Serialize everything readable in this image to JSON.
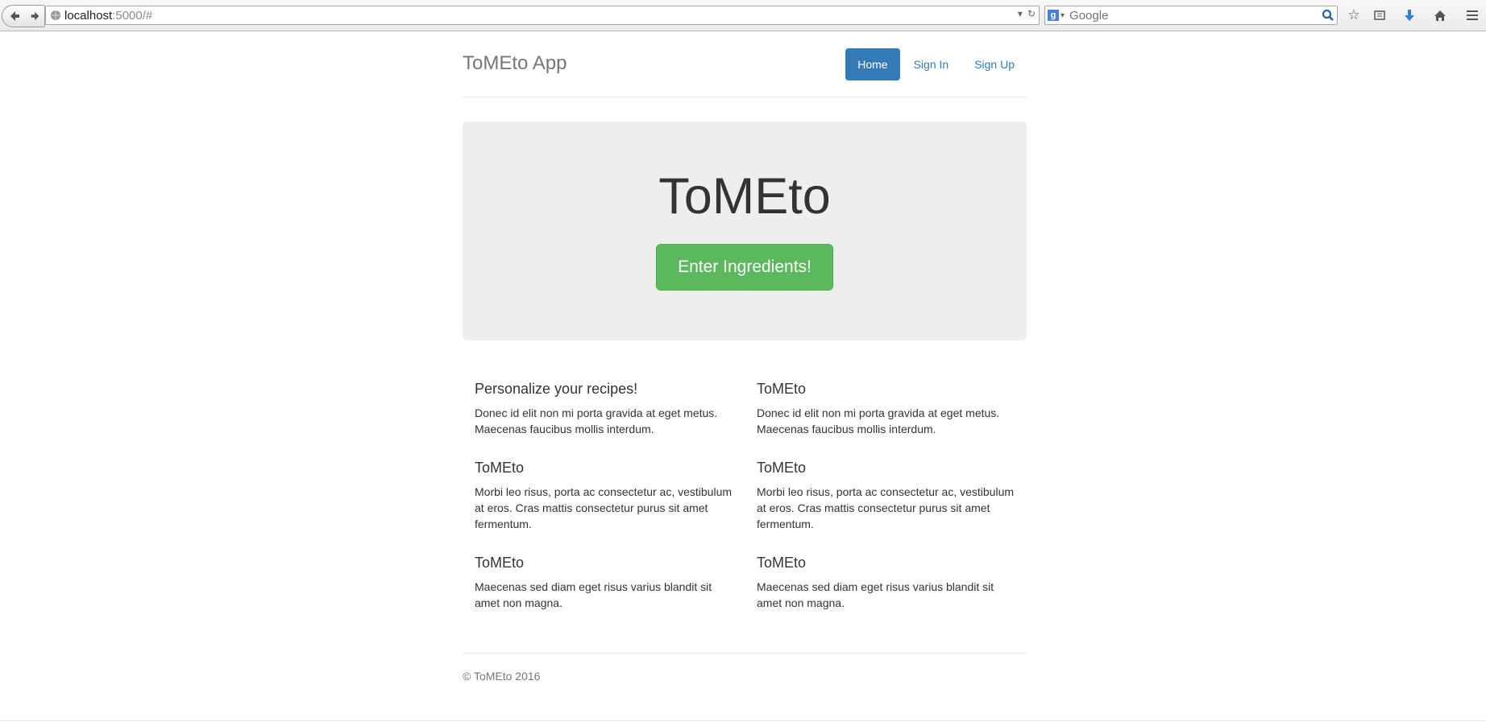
{
  "browser": {
    "url_host": "localhost",
    "url_rest": ":5000/#",
    "search_placeholder": "Google"
  },
  "header": {
    "brand": "ToMEto App",
    "nav": [
      "Home",
      "Sign In",
      "Sign Up"
    ]
  },
  "jumbotron": {
    "title": "ToMEto",
    "button": "Enter Ingredients!"
  },
  "marketing": {
    "left": [
      {
        "title": "Personalize your recipes!",
        "text": "Donec id elit non mi porta gravida at eget metus. Maecenas faucibus mollis interdum."
      },
      {
        "title": "ToMEto",
        "text": "Morbi leo risus, porta ac consectetur ac, vestibulum at eros. Cras mattis consectetur purus sit amet fermentum."
      },
      {
        "title": "ToMEto",
        "text": "Maecenas sed diam eget risus varius blandit sit amet non magna."
      }
    ],
    "right": [
      {
        "title": "ToMEto",
        "text": "Donec id elit non mi porta gravida at eget metus. Maecenas faucibus mollis interdum."
      },
      {
        "title": "ToMEto",
        "text": "Morbi leo risus, porta ac consectetur ac, vestibulum at eros. Cras mattis consectetur purus sit amet fermentum."
      },
      {
        "title": "ToMEto",
        "text": "Maecenas sed diam eget risus varius blandit sit amet non magna."
      }
    ]
  },
  "footer": {
    "text": "© ToMEto 2016"
  },
  "colors": {
    "primary": "#337ab7",
    "success": "#5cb85c",
    "jumbotron_bg": "#eeeeee"
  },
  "icons": [
    "back-arrow-icon",
    "forward-arrow-icon",
    "globe-icon",
    "dropdown-icon",
    "reload-icon",
    "google-icon",
    "search-icon",
    "bookmark-star-icon",
    "reading-list-icon",
    "download-icon",
    "home-icon",
    "menu-icon"
  ]
}
